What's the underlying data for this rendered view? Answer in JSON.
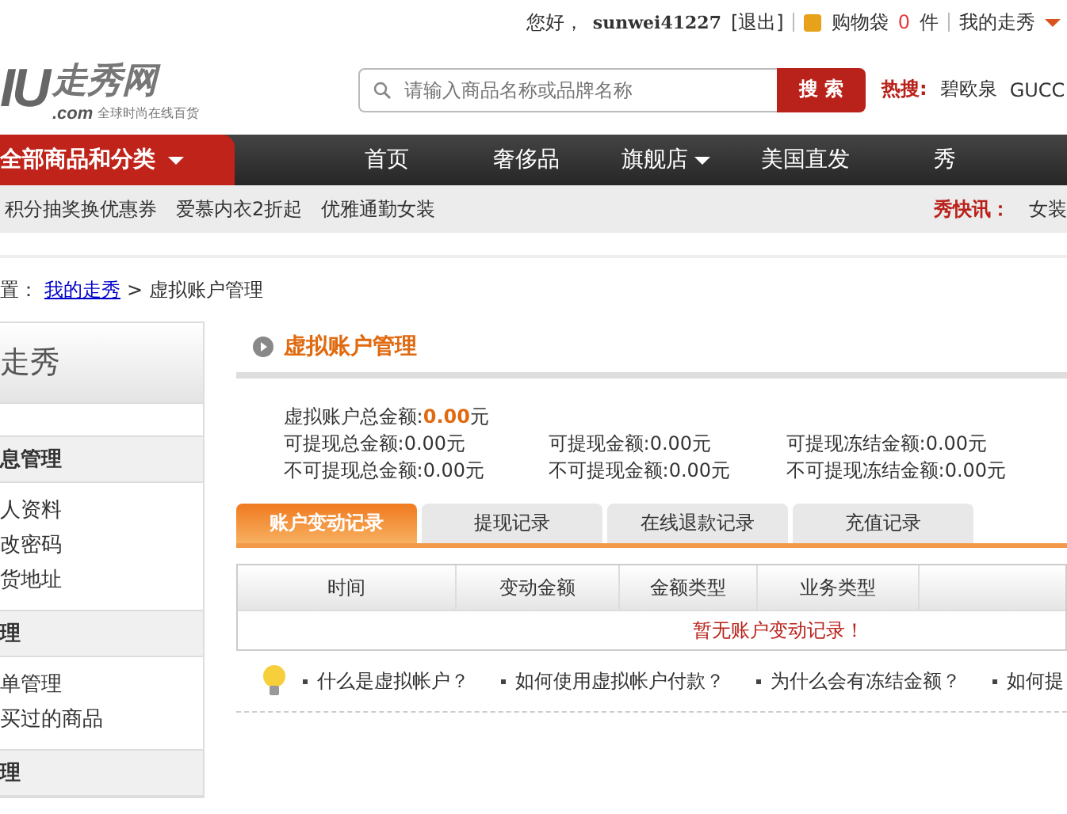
{
  "top_bar": {
    "greeting": "您好，",
    "username": "sunwei41227",
    "logout": "[退出]",
    "cart_label": "购物袋",
    "cart_count": "0",
    "cart_unit": "件",
    "my_account": "我的走秀"
  },
  "logo": {
    "mark": "IU",
    "dotcom": ".com",
    "name": "走秀网",
    "slogan": "全球时尚在线百货"
  },
  "search": {
    "placeholder": "请输入商品名称或品牌名称",
    "button": "搜 索"
  },
  "hot_search": {
    "label": "热搜:",
    "items": [
      "碧欧泉",
      "GUCC"
    ]
  },
  "nav": {
    "category_button": "全部商品和分类",
    "items": [
      {
        "label": "首页",
        "dropdown": false
      },
      {
        "label": "奢侈品",
        "dropdown": false
      },
      {
        "label": "旗舰店",
        "dropdown": true
      },
      {
        "label": "美国直发",
        "dropdown": false
      },
      {
        "label": "秀",
        "dropdown": false
      }
    ]
  },
  "promo_bar": {
    "links": [
      "积分抽奖换优惠券",
      "爱慕内衣2折起",
      "优雅通勤女装"
    ],
    "news_label": "秀快讯：",
    "news": "女装"
  },
  "breadcrumb": {
    "prefix": "置：",
    "link": "我的走秀",
    "separator": ">",
    "current": "虚拟账户管理"
  },
  "sidebar": {
    "title": "走秀",
    "sections": [
      {
        "heading": "息管理",
        "items": [
          "人资料",
          "改密码",
          "货地址"
        ]
      },
      {
        "heading": "理",
        "items": [
          "单管理",
          "买过的商品"
        ]
      },
      {
        "heading": "理"
      }
    ]
  },
  "main": {
    "title": "虚拟账户管理",
    "total": "虚拟账户总金额:**0.00**元",
    "balances": [
      "可提现总金额:0.00元",
      "可提现金额:0.00元",
      "可提现冻结金额:0.00元",
      "不可提现总金额:0.00元",
      "不可提现金额:0.00元",
      "不可提现冻结金额:0.00元"
    ],
    "tabs": [
      {
        "label": "账户变动记录",
        "selected": true
      },
      {
        "label": "提现记录",
        "selected": false
      },
      {
        "label": "在线退款记录",
        "selected": false
      },
      {
        "label": "充值记录",
        "selected": false
      }
    ],
    "table": {
      "columns": [
        "时间",
        "变动金额",
        "金额类型",
        "业务类型"
      ],
      "empty_message": "暂无账户变动记录！"
    },
    "help_links": [
      "什么是虚拟帐户？",
      "如何使用虚拟帐户付款？",
      "为什么会有冻结金额？",
      "如何提"
    ]
  }
}
